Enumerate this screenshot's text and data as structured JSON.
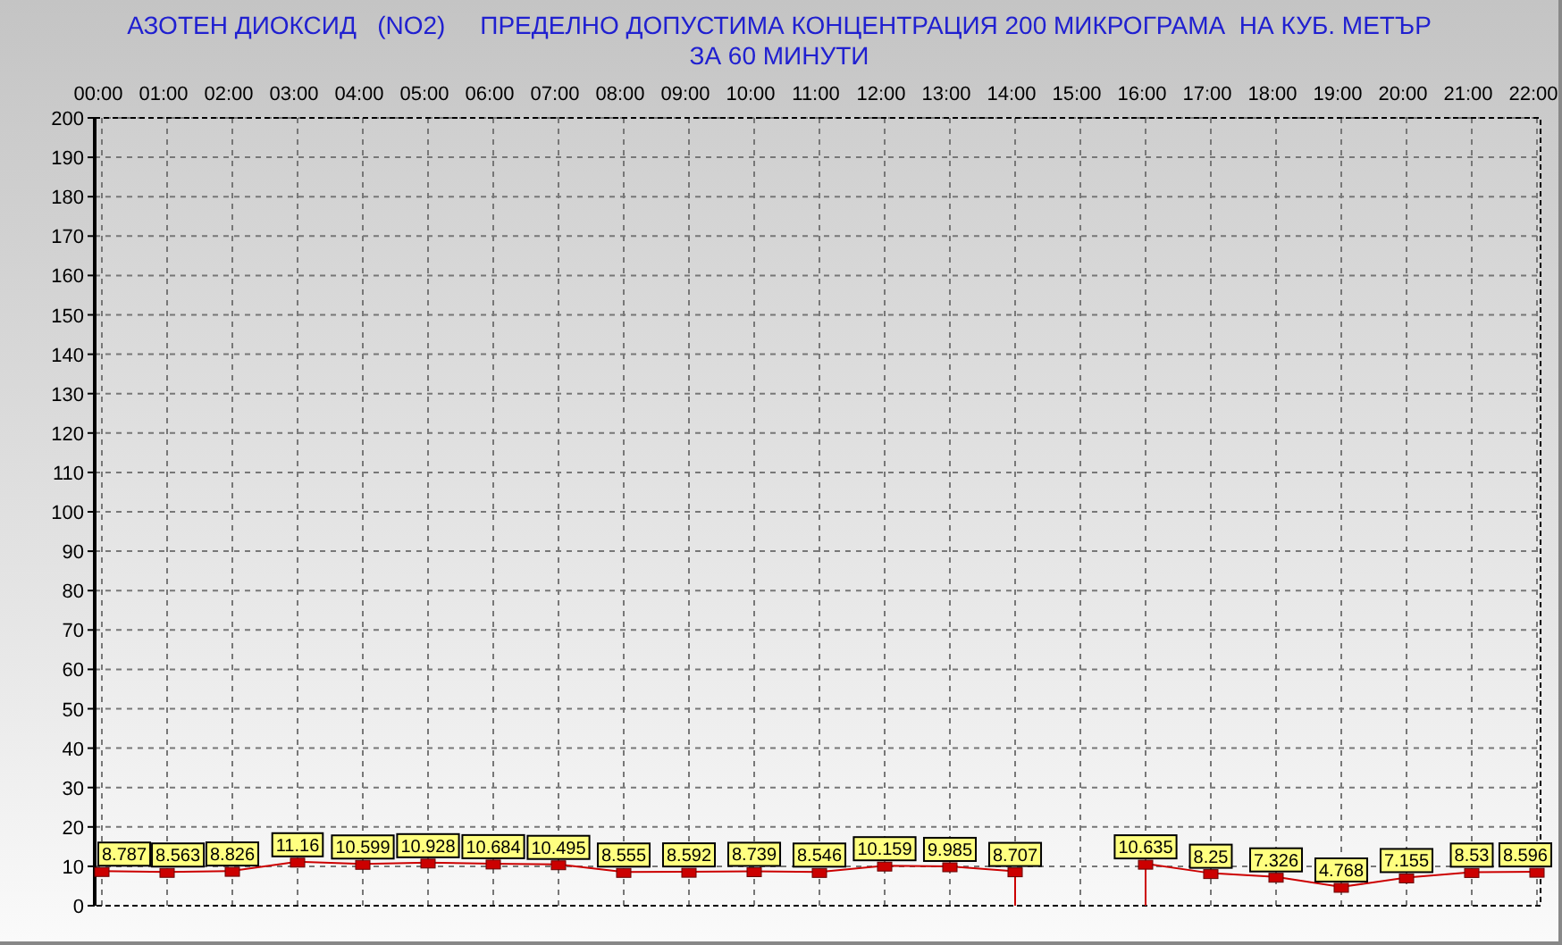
{
  "header": {
    "lines": [
      "АЗОТЕН ДИОКСИД   (NO2)     ПРЕДЕЛНО ДОПУСТИМА КОНЦЕНТРАЦИЯ 200 МИКРОГРАМА  НА КУБ. МЕТЪР",
      "ЗА 60 МИНУТИ"
    ]
  },
  "chart_data": {
    "type": "line",
    "categories": [
      "00:00",
      "01:00",
      "02:00",
      "03:00",
      "04:00",
      "05:00",
      "06:00",
      "07:00",
      "08:00",
      "09:00",
      "10:00",
      "11:00",
      "12:00",
      "13:00",
      "14:00",
      "15:00",
      "16:00",
      "17:00",
      "18:00",
      "19:00",
      "20:00",
      "21:00",
      "22:00"
    ],
    "series": [
      {
        "color": "#cc0000",
        "marker": true,
        "values": [
          8.787,
          8.563,
          8.826,
          11.16,
          10.599,
          10.928,
          10.684,
          10.495,
          8.555,
          8.592,
          8.739,
          8.546,
          10.159,
          9.985,
          8.707,
          null,
          10.635,
          8.25,
          7.326,
          4.768,
          7.155,
          8.53,
          8.596
        ]
      }
    ],
    "ylim": [
      0,
      200
    ],
    "yticks": [
      0,
      10,
      20,
      30,
      40,
      50,
      60,
      70,
      80,
      90,
      100,
      110,
      120,
      130,
      140,
      150,
      160,
      170,
      180,
      190,
      200
    ],
    "grid": true,
    "data_labels": true
  }
}
